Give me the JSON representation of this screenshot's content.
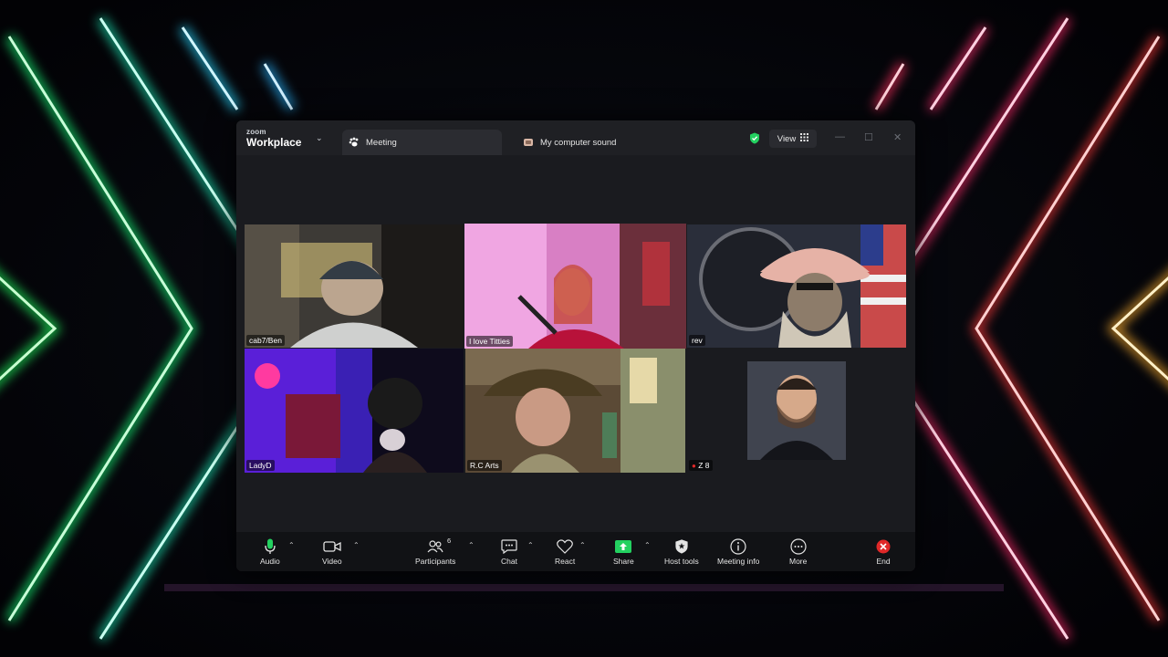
{
  "app": {
    "brand_small": "zoom",
    "brand_big": "Workplace"
  },
  "tabs": [
    {
      "label": "Meeting",
      "icon": "paw-icon",
      "active": true
    },
    {
      "label": "My computer sound",
      "icon": "audio-share-icon",
      "active": false
    }
  ],
  "header": {
    "view_label": "View",
    "security_icon": "shield-check-icon"
  },
  "participants": [
    {
      "name": "cab7/Ben"
    },
    {
      "name": "I love Titties",
      "speaking": true
    },
    {
      "name": "rev"
    },
    {
      "name": "LadyD"
    },
    {
      "name": "R.C Arts"
    },
    {
      "name": "Z 8",
      "muted": true
    }
  ],
  "toolbar": {
    "audio": "Audio",
    "video": "Video",
    "participants": "Participants",
    "participants_count": "6",
    "chat": "Chat",
    "react": "React",
    "share": "Share",
    "host_tools": "Host tools",
    "meeting_info": "Meeting info",
    "more": "More",
    "end": "End"
  },
  "colors": {
    "speaker_outline": "#23d160",
    "share_green": "#23d160",
    "end_red": "#e02828",
    "mic_green": "#23d160"
  }
}
